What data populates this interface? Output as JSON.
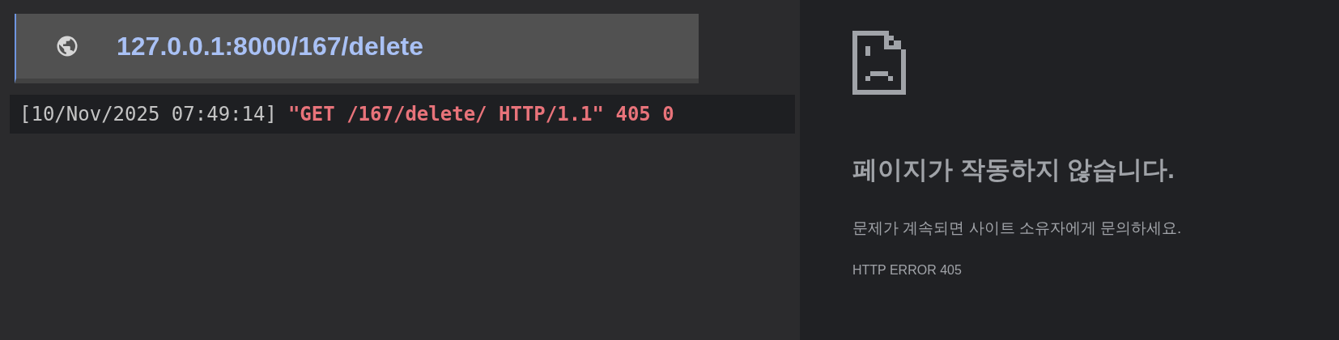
{
  "address_bar": {
    "url": "127.0.0.1:8000/167/delete"
  },
  "log_line": {
    "timestamp": "[10/Nov/2025 07:49:14]",
    "request": "\"GET /167/delete/ HTTP/1.1\" 405 0"
  },
  "error_page": {
    "title": "페이지가 작동하지 않습니다.",
    "message": "문제가 계속되면 사이트 소유자에게 문의하세요.",
    "code": "HTTP ERROR 405"
  }
}
